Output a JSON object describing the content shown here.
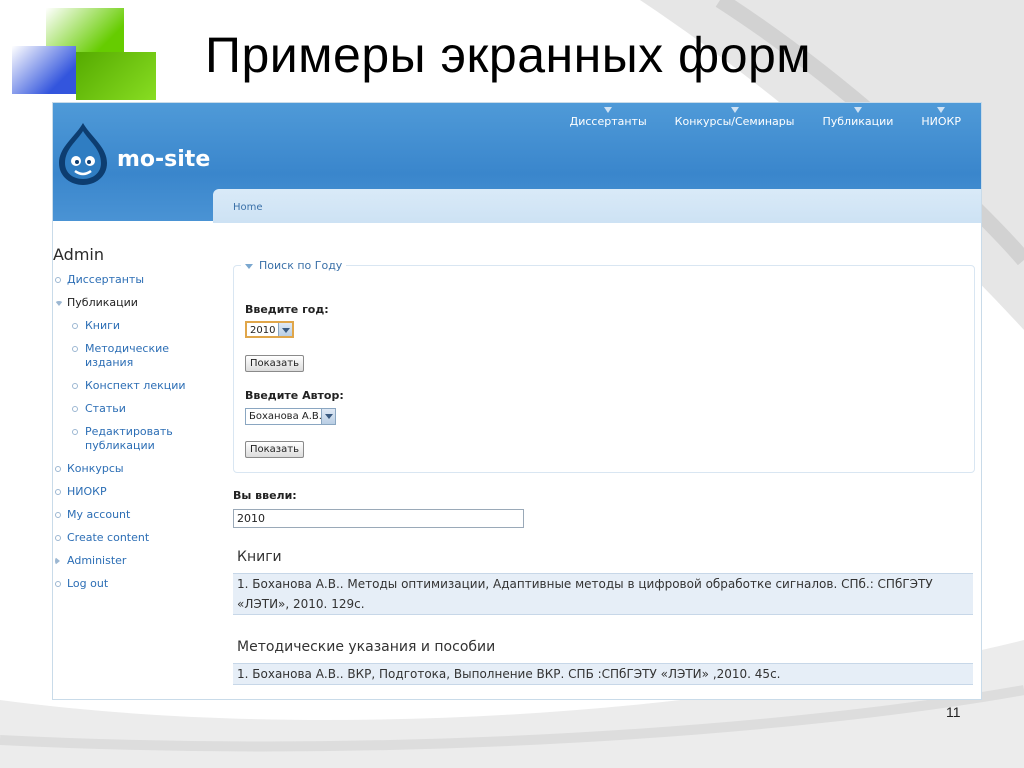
{
  "slide": {
    "title": "Примеры экранных форм",
    "page_number": "11"
  },
  "site": {
    "name": "mo-site",
    "top_nav": [
      "Диссертанты",
      "Конкурсы/Семинары",
      "Публикации",
      "НИОКР"
    ],
    "breadcrumb": "Home"
  },
  "sidebar": {
    "title": "Admin",
    "items": [
      {
        "label": "Диссертанты",
        "state": "leaf"
      },
      {
        "label": "Публикации",
        "state": "expanded"
      },
      {
        "label": "Книги",
        "state": "child"
      },
      {
        "label": "Методические издания",
        "state": "child"
      },
      {
        "label": "Конспект лекции",
        "state": "child"
      },
      {
        "label": "Статьи",
        "state": "child"
      },
      {
        "label": "Редактировать публикации",
        "state": "child"
      },
      {
        "label": "Конкурсы",
        "state": "leaf"
      },
      {
        "label": "НИОКР",
        "state": "leaf"
      },
      {
        "label": "My account",
        "state": "leaf"
      },
      {
        "label": "Create content",
        "state": "leaf"
      },
      {
        "label": "Administer",
        "state": "collapsed"
      },
      {
        "label": "Log out",
        "state": "leaf"
      }
    ]
  },
  "search_form": {
    "legend": "Поиск по Году",
    "year_label": "Введите год:",
    "year_value": "2010",
    "submit1": "Показать",
    "author_label": "Введите Автор:",
    "author_value": "Боханова А.В.",
    "submit2": "Показать"
  },
  "result": {
    "entered_label": "Вы ввели:",
    "entered_value": "2010",
    "sections": [
      {
        "title": "Книги",
        "entries": [
          "1. Боханова А.В.. Методы оптимизации, Адаптивные методы в цифровой обработке сигналов. СПб.: СПбГЭТУ «ЛЭТИ», 2010. 129с."
        ]
      },
      {
        "title": "Методические указания и пособии",
        "entries": [
          "1. Боханова А.В.. ВКР, Подготока, Выполнение ВКР. СПБ :СПбГЭТУ «ЛЭТИ» ,2010. 45с."
        ]
      }
    ]
  },
  "colors": {
    "header_blue": "#3a86cc",
    "link_blue": "#2c6eb5",
    "deco_green": "#66cc00",
    "deco_blue": "#3355dd"
  }
}
